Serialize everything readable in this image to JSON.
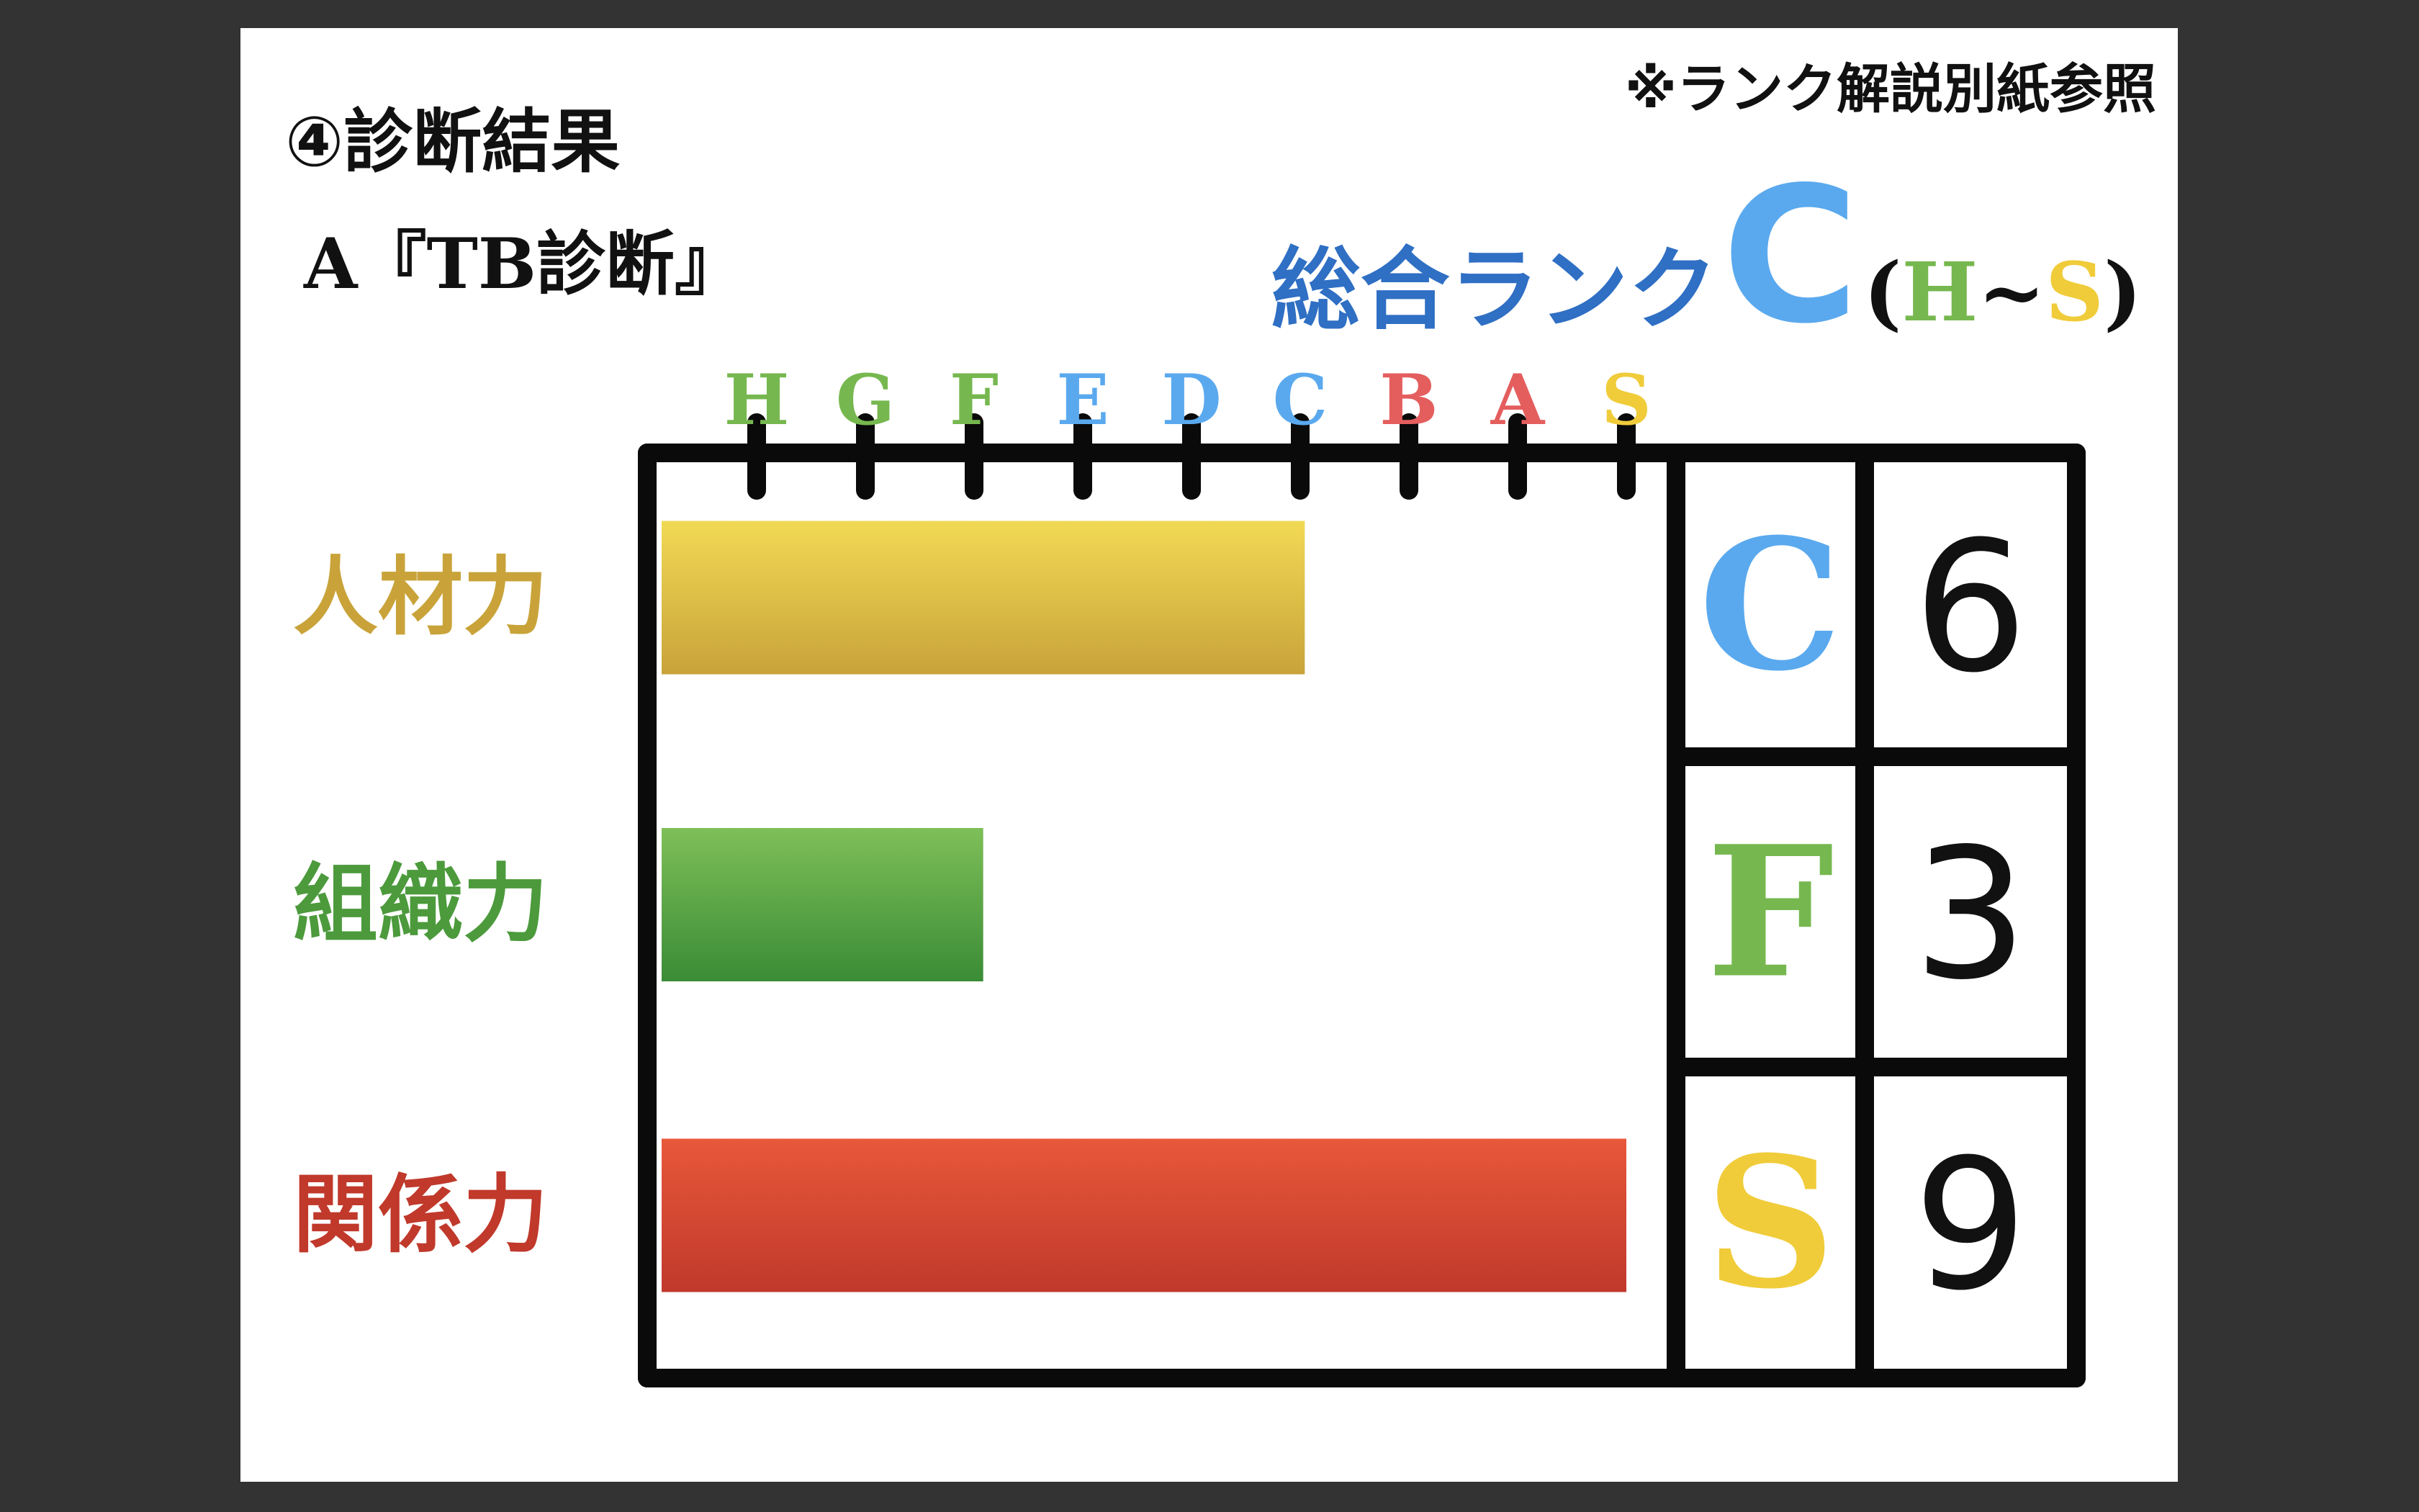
{
  "header": {
    "section_title": "④診断結果",
    "subtitle": "A『TB診断』",
    "note": "※ランク解説別紙参照"
  },
  "overall": {
    "label": "総合ランク",
    "rank": "C",
    "range_open": "(",
    "range_low": "H",
    "range_sep": "~",
    "range_high": "S",
    "range_close": ")"
  },
  "colors": {
    "green_rank": "#76b84f",
    "blue_rank": "#5aa9ee",
    "red_rank": "#e45e5e",
    "yellow_rank": "#f0cc3a",
    "frame": "#0a0a0a"
  },
  "chart_data": {
    "type": "bar",
    "orientation": "horizontal",
    "rank_scale": [
      "H",
      "G",
      "F",
      "E",
      "D",
      "C",
      "B",
      "A",
      "S"
    ],
    "rank_colors": [
      "#76b84f",
      "#76b84f",
      "#76b84f",
      "#5aa9ee",
      "#5aa9ee",
      "#5aa9ee",
      "#e45e5e",
      "#e45e5e",
      "#f0cc3a"
    ],
    "categories": [
      "人材力",
      "組織力",
      "関係力"
    ],
    "category_colors": [
      "#c9a33a",
      "#4c9a3c",
      "#c0392b"
    ],
    "values": [
      6,
      3,
      9
    ],
    "ranks": [
      "C",
      "F",
      "S"
    ],
    "bar_colors": [
      [
        "#f1d954",
        "#c9a33a"
      ],
      [
        "#7ebf58",
        "#3a8c36"
      ],
      [
        "#e8583a",
        "#c0392b"
      ]
    ],
    "xlim": [
      0,
      9
    ],
    "grid": false
  }
}
